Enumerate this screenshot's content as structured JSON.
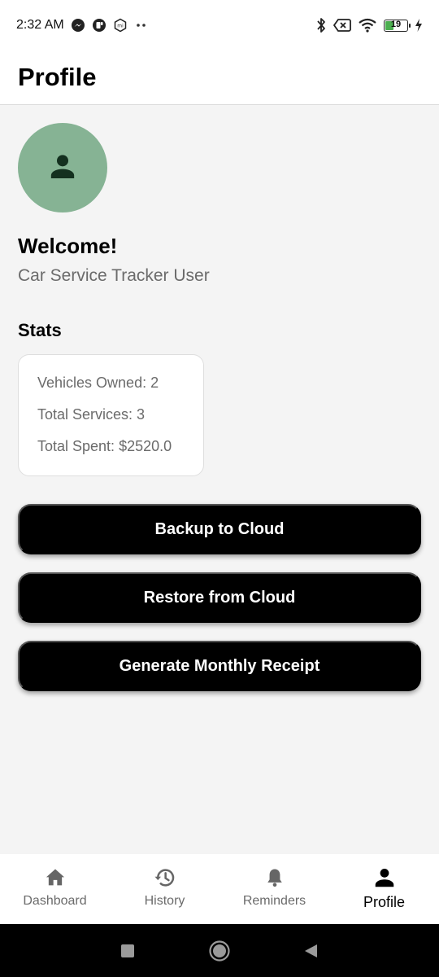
{
  "status_bar": {
    "time": "2:32 AM",
    "battery_level": "19",
    "icons": [
      "messenger-icon",
      "app-icon",
      "mi-icon",
      "more-dots-icon",
      "bluetooth-icon",
      "sim-off-icon",
      "wifi-icon",
      "battery-icon",
      "charging-icon"
    ]
  },
  "header": {
    "title": "Profile"
  },
  "profile": {
    "avatar_icon": "person-icon",
    "avatar_color": "#86b394",
    "welcome": "Welcome!",
    "subtitle": "Car Service Tracker User"
  },
  "stats": {
    "heading": "Stats",
    "lines": [
      "Vehicles Owned: 2",
      "Total Services: 3",
      "Total Spent: $2520.0"
    ]
  },
  "actions": {
    "backup_label": "Backup to Cloud",
    "restore_label": "Restore from Cloud",
    "receipt_label": "Generate Monthly Receipt"
  },
  "bottom_nav": {
    "items": [
      {
        "label": "Dashboard",
        "icon": "home-icon"
      },
      {
        "label": "History",
        "icon": "history-icon"
      },
      {
        "label": "Reminders",
        "icon": "bell-icon"
      },
      {
        "label": "Profile",
        "icon": "person-icon",
        "active": true
      }
    ]
  },
  "system_nav": {
    "icons": [
      "square-recents-icon",
      "circle-home-icon",
      "triangle-back-icon"
    ]
  }
}
